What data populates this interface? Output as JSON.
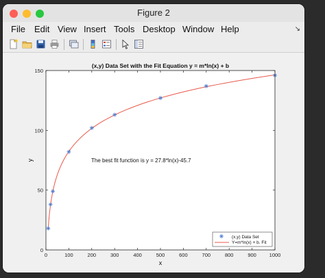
{
  "window": {
    "title": "Figure 2"
  },
  "menu": [
    "File",
    "Edit",
    "View",
    "Insert",
    "Tools",
    "Desktop",
    "Window",
    "Help"
  ],
  "toolbar_icons": [
    "new-file-icon",
    "open-folder-icon",
    "save-icon",
    "print-icon",
    "link-icon",
    "colorbar-icon",
    "legend-icon",
    "pointer-icon",
    "property-editor-icon"
  ],
  "chart_data": {
    "type": "scatter",
    "title": "(x,y) Data Set with the Fit Equation y = m*ln(x) + b",
    "xlabel": "x",
    "ylabel": "y",
    "xlim": [
      0,
      1000
    ],
    "ylim": [
      0,
      150
    ],
    "xticks": [
      0,
      100,
      200,
      300,
      400,
      500,
      600,
      700,
      800,
      900,
      1000
    ],
    "yticks": [
      0,
      50,
      100,
      150
    ],
    "annotation": "The best fit function is y = 27.8*ln(x)-45.7",
    "grid": false,
    "legend_position": "bottom-right",
    "series": [
      {
        "name": "(x,y) Data Set",
        "marker": "*",
        "color": "#4a7bd0",
        "x": [
          10,
          20,
          30,
          100,
          200,
          300,
          500,
          700,
          1000
        ],
        "y": [
          18,
          38,
          49,
          82,
          102,
          113,
          127,
          137,
          146
        ]
      },
      {
        "name": "Y=m*ln(x) + b. Fit",
        "style": "line",
        "color": "#e8584a",
        "fit": {
          "m": 27.8,
          "b": -45.7,
          "x_from": 10,
          "x_to": 1000
        }
      }
    ]
  }
}
